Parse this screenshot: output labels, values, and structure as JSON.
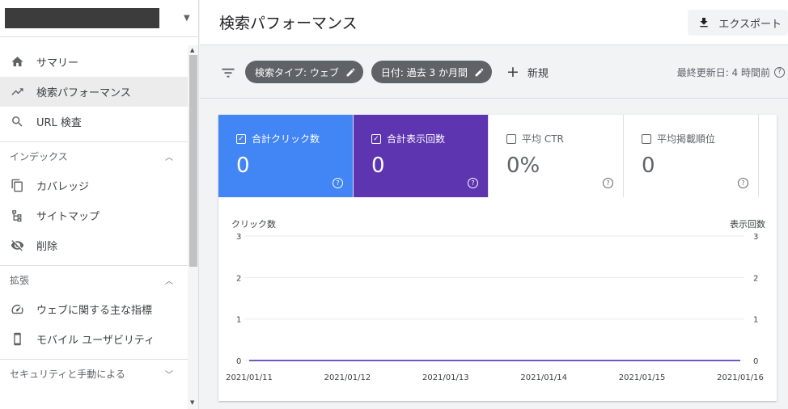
{
  "sidebar": {
    "property_caret": "▼",
    "nav_items": [
      {
        "label": "サマリー",
        "icon": "home-icon"
      },
      {
        "label": "検索パフォーマンス",
        "icon": "trending-up-icon",
        "active": true
      },
      {
        "label": "URL 検査",
        "icon": "search-icon"
      }
    ],
    "sections": [
      {
        "title": "インデックス",
        "items": [
          {
            "label": "カバレッジ",
            "icon": "copy-icon"
          },
          {
            "label": "サイトマップ",
            "icon": "sitemap-icon"
          },
          {
            "label": "削除",
            "icon": "visibility-off-icon"
          }
        ]
      },
      {
        "title": "拡張",
        "items": [
          {
            "label": "ウェブに関する主な指標",
            "icon": "speed-icon"
          },
          {
            "label": "モバイル ユーザビリティ",
            "icon": "phone-icon"
          }
        ]
      },
      {
        "title": "セキュリティと手動による",
        "items": []
      }
    ]
  },
  "header": {
    "title": "検索パフォーマンス",
    "export_label": "エクスポート"
  },
  "filters": {
    "chips": [
      "検索タイプ: ウェブ",
      "日付: 過去 3 か月間"
    ],
    "new_label": "新規",
    "updated_label": "最終更新日: 4 時間前"
  },
  "metrics": [
    {
      "label": "合計クリック数",
      "value": "0",
      "checked": true,
      "color": "#4285f4"
    },
    {
      "label": "合計表示回数",
      "value": "0",
      "checked": true,
      "color": "#5e35b1"
    },
    {
      "label": "平均 CTR",
      "value": "0%",
      "checked": false
    },
    {
      "label": "平均掲載順位",
      "value": "0",
      "checked": false
    }
  ],
  "chart_data": {
    "type": "line",
    "ylabel": "クリック数",
    "y2label": "表示回数",
    "ylim": [
      0,
      3
    ],
    "yticks": [
      "3",
      "2",
      "1",
      "0"
    ],
    "x": [
      "2021/01/11",
      "2021/01/12",
      "2021/01/13",
      "2021/01/14",
      "2021/01/15",
      "2021/01/16"
    ],
    "series": [
      {
        "values": [
          0,
          0,
          0,
          0,
          0,
          0
        ],
        "color": "#4285f4"
      },
      {
        "values": [
          0,
          0,
          0,
          0,
          0,
          0
        ],
        "color": "#5e35b1"
      }
    ],
    "grid": true
  }
}
